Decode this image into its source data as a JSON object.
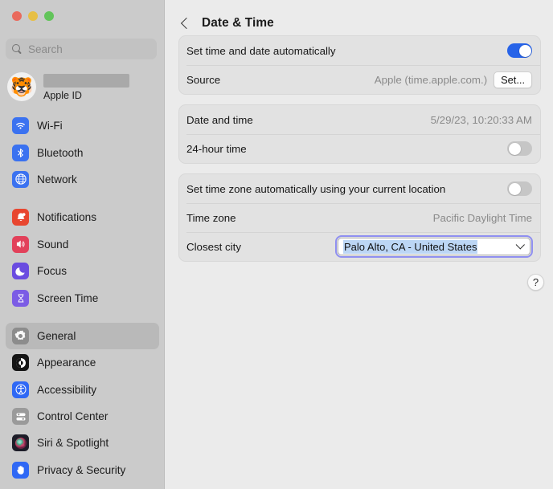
{
  "window": {
    "traffic_lights": [
      "close",
      "minimize",
      "zoom"
    ],
    "colors": {
      "sidebar_bg": "#cbcbcb",
      "content_bg": "#ebebeb",
      "card_bg": "#e2e2e2",
      "toggle_on": "#2763e8",
      "toggle_off": "#c6c6c6",
      "focus_ring": "#8f8ff0",
      "selection": "#bcd6f5"
    }
  },
  "sidebar": {
    "search": {
      "placeholder": "Search",
      "value": ""
    },
    "account": {
      "avatar_glyph": "🐯",
      "name_redacted": true,
      "subtitle": "Apple ID"
    },
    "groups": [
      {
        "items": [
          {
            "label": "Wi-Fi",
            "icon": "wifi-icon",
            "color": "#3b72f0",
            "selected": false
          },
          {
            "label": "Bluetooth",
            "icon": "bluetooth-icon",
            "color": "#3b72f0",
            "selected": false
          },
          {
            "label": "Network",
            "icon": "globe-icon",
            "color": "#3b72f0",
            "selected": false
          }
        ]
      },
      {
        "items": [
          {
            "label": "Notifications",
            "icon": "bell-icon",
            "color": "#e8462f",
            "selected": false
          },
          {
            "label": "Sound",
            "icon": "speaker-icon",
            "color": "#e2415a",
            "selected": false
          },
          {
            "label": "Focus",
            "icon": "moon-icon",
            "color": "#6a4ce0",
            "selected": false
          },
          {
            "label": "Screen Time",
            "icon": "hourglass-icon",
            "color": "#7b5ce5",
            "selected": false
          }
        ]
      },
      {
        "items": [
          {
            "label": "General",
            "icon": "gear-icon",
            "color": "#8c8c8c",
            "selected": true
          },
          {
            "label": "Appearance",
            "icon": "contrast-icon",
            "color": "#141414",
            "selected": false
          },
          {
            "label": "Accessibility",
            "icon": "accessibility-icon",
            "color": "#2f68f5",
            "selected": false
          },
          {
            "label": "Control Center",
            "icon": "sliders-icon",
            "color": "#9a9a9a",
            "selected": false
          },
          {
            "label": "Siri & Spotlight",
            "icon": "siri-orb-icon",
            "color": "#1d1d28",
            "selected": false
          },
          {
            "label": "Privacy & Security",
            "icon": "hand-icon",
            "color": "#2f68f5",
            "selected": false
          }
        ]
      }
    ]
  },
  "main": {
    "back_label": "Back",
    "title": "Date & Time",
    "help_label": "?",
    "cards": [
      {
        "rows": [
          {
            "type": "toggle",
            "label": "Set time and date automatically",
            "state": "on"
          },
          {
            "type": "value-button",
            "label": "Source",
            "value": "Apple (time.apple.com.)",
            "button": "Set..."
          }
        ]
      },
      {
        "rows": [
          {
            "type": "value",
            "label": "Date and time",
            "value": "5/29/23, 10:20:33 AM"
          },
          {
            "type": "toggle",
            "label": "24-hour time",
            "state": "off"
          }
        ]
      },
      {
        "rows": [
          {
            "type": "toggle",
            "label": "Set time zone automatically using your current location",
            "state": "off"
          },
          {
            "type": "value",
            "label": "Time zone",
            "value": "Pacific Daylight Time"
          },
          {
            "type": "combo",
            "label": "Closest city",
            "value": "Palo Alto, CA - United States",
            "focused": true,
            "text_selected": true
          }
        ]
      }
    ]
  }
}
